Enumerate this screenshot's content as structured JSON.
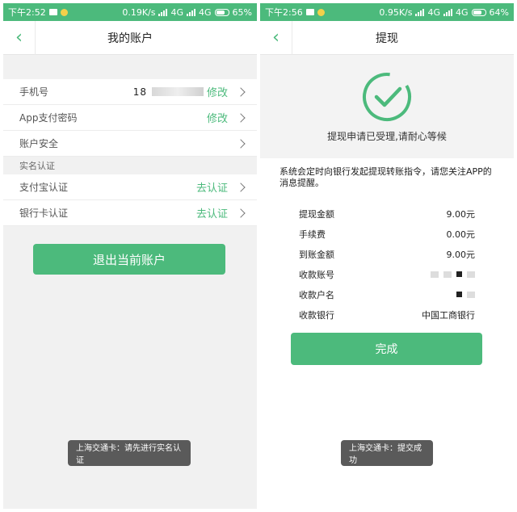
{
  "left": {
    "status": {
      "time": "下午2:52",
      "speed": "0.19K/s",
      "net1": "4G",
      "net2": "4G",
      "battery": "65%"
    },
    "nav": {
      "title": "我的账户"
    },
    "account": {
      "phone_label": "手机号",
      "phone_value": "18",
      "phone_action": "修改",
      "paypwd_label": "App支付密码",
      "paypwd_action": "修改",
      "security_label": "账户安全"
    },
    "verify": {
      "header": "实名认证",
      "alipay_label": "支付宝认证",
      "alipay_action": "去认证",
      "bank_label": "银行卡认证",
      "bank_action": "去认证"
    },
    "logout_label": "退出当前账户",
    "toast": "上海交通卡：请先进行实名认证"
  },
  "right": {
    "status": {
      "time": "下午2:56",
      "speed": "0.95K/s",
      "net1": "4G",
      "net2": "4G",
      "battery": "64%"
    },
    "nav": {
      "title": "提现"
    },
    "success_text": "提现申请已受理,请耐心等候",
    "notice": "系统会定时向银行发起提现转账指令，请您关注APP的消息提醒。",
    "details": [
      {
        "label": "提现金额",
        "value": "9.00元"
      },
      {
        "label": "手续费",
        "value": "0.00元"
      },
      {
        "label": "到账金额",
        "value": "9.00元"
      },
      {
        "label": "收款账号",
        "value": ""
      },
      {
        "label": "收款户名",
        "value": ""
      },
      {
        "label": "收款银行",
        "value": "中国工商银行"
      }
    ],
    "done_label": "完成",
    "toast": "上海交通卡：提交成功"
  },
  "colors": {
    "accent": "#4cba7c",
    "toast_bg": "#5a5a5a"
  }
}
